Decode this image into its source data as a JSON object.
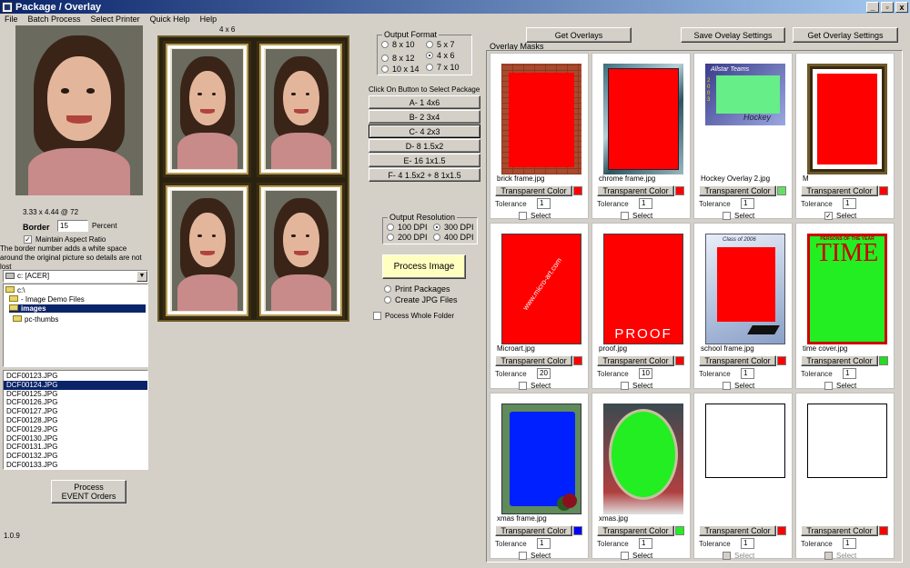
{
  "window": {
    "title": "Package / Overlay",
    "minimize": "_",
    "maximize": "▫",
    "close": "x"
  },
  "menu": [
    "File",
    "Batch Process",
    "Select Printer",
    "Quick Help",
    "Help"
  ],
  "preview": {
    "dims": "3.33 x 4.44 @ 72"
  },
  "border": {
    "label": "Border",
    "value": "15",
    "unit": "Percent",
    "maintain_label": "Maintain Aspect Ratio",
    "help": "The border number adds a white space around the original picture so details are not lost"
  },
  "drive": {
    "value": "c: [ACER]"
  },
  "folders": [
    {
      "label": "c:\\",
      "selected": false,
      "indent": 0
    },
    {
      "label": "- Image Demo Files",
      "selected": false,
      "indent": 1
    },
    {
      "label": "images",
      "selected": true,
      "indent": 1
    },
    {
      "label": "pc-thumbs",
      "selected": false,
      "indent": 1
    }
  ],
  "files": [
    {
      "label": "DCF00123.JPG",
      "selected": false
    },
    {
      "label": "DCF00124.JPG",
      "selected": true
    },
    {
      "label": "DCF00125.JPG",
      "selected": false
    },
    {
      "label": "DCF00126.JPG",
      "selected": false
    },
    {
      "label": "DCF00127.JPG",
      "selected": false
    },
    {
      "label": "DCF00128.JPG",
      "selected": false
    },
    {
      "label": "DCF00129.JPG",
      "selected": false
    },
    {
      "label": "DCF00130.JPG",
      "selected": false
    },
    {
      "label": "DCF00131.JPG",
      "selected": false
    },
    {
      "label": "DCF00132.JPG",
      "selected": false
    },
    {
      "label": "DCF00133.JPG",
      "selected": false
    }
  ],
  "process_event": "Process EVENT Orders",
  "version": "1.0.9",
  "package_size_label": "4 x 6",
  "output_format": {
    "label": "Output Format",
    "options": [
      {
        "label": "8 x 10",
        "checked": false
      },
      {
        "label": "5 x 7",
        "checked": false
      },
      {
        "label": "8 x 12",
        "checked": false
      },
      {
        "label": "4 x 6",
        "checked": true
      },
      {
        "label": "10 x 14",
        "checked": false
      },
      {
        "label": "7 x 10",
        "checked": false
      }
    ]
  },
  "packages": {
    "header": "Click On Button to Select Package",
    "items": [
      "A- 1 4x6",
      "B- 2 3x4",
      "C- 4 2x3",
      "D- 8 1.5x2",
      "E- 16 1x1.5",
      "F- 4 1.5x2 + 8 1x1.5"
    ],
    "selected_index": 2
  },
  "output_resolution": {
    "label": "Output Resolution",
    "options": [
      {
        "label": "100 DPI",
        "checked": false
      },
      {
        "label": "300 DPI",
        "checked": true
      },
      {
        "label": "200 DPI",
        "checked": false
      },
      {
        "label": "400 DPI",
        "checked": false
      }
    ]
  },
  "process_image": "Process Image",
  "output_mode": [
    {
      "label": "Print Packages",
      "checked": false
    },
    {
      "label": "Create JPG Files",
      "checked": false
    }
  ],
  "process_folder": "Pocess Whole Folder",
  "toolbar": {
    "get_overlays": "Get Overlays",
    "save_settings": "Save Ovelay Settings",
    "get_settings": "Get Overlay Settings"
  },
  "overlay_masks": {
    "label": "Overlay Masks",
    "tc_label": "Transparent Color",
    "tol_label": "Tolerance",
    "select_label": "Select",
    "items": [
      {
        "file": "brick frame.jpg",
        "swatch": "#ff0000",
        "tolerance": "1",
        "selected": false,
        "disabled": false
      },
      {
        "file": "chrome frame.jpg",
        "swatch": "#ff0000",
        "tolerance": "1",
        "selected": false,
        "disabled": false
      },
      {
        "file": "Hockey Overlay 2.jpg",
        "swatch": "#66dd66",
        "tolerance": "1",
        "selected": false,
        "disabled": false
      },
      {
        "file": "M",
        "swatch": "#ff0000",
        "tolerance": "1",
        "selected": true,
        "disabled": false
      },
      {
        "file": "Microart.jpg",
        "swatch": "#ff0000",
        "tolerance": "20",
        "selected": false,
        "disabled": false
      },
      {
        "file": "proof.jpg",
        "swatch": "#ff0000",
        "tolerance": "10",
        "selected": false,
        "disabled": false
      },
      {
        "file": "school frame.jpg",
        "swatch": "#ff0000",
        "tolerance": "1",
        "selected": false,
        "disabled": false
      },
      {
        "file": "time cover.jpg",
        "swatch": "#22dd22",
        "tolerance": "1",
        "selected": false,
        "disabled": false
      },
      {
        "file": "xmas frame.jpg",
        "swatch": "#0000ff",
        "tolerance": "1",
        "selected": false,
        "disabled": false
      },
      {
        "file": "xmas.jpg",
        "swatch": "#22ee22",
        "tolerance": "1",
        "selected": false,
        "disabled": false
      },
      {
        "file": "",
        "swatch": "#ff0000",
        "tolerance": "1",
        "selected": false,
        "disabled": true
      },
      {
        "file": "",
        "swatch": "#ff0000",
        "tolerance": "1",
        "selected": false,
        "disabled": true
      }
    ],
    "thumb_text": {
      "hockey_title": "Allstar Teams",
      "hockey_year": "2003",
      "hockey_word": "Hockey",
      "microart": "www.micro-art.com",
      "proof": "PROOF",
      "school": "Class of 2006",
      "time_header": "PERSONS OF THE YEAR",
      "time_title": "TIME"
    }
  }
}
